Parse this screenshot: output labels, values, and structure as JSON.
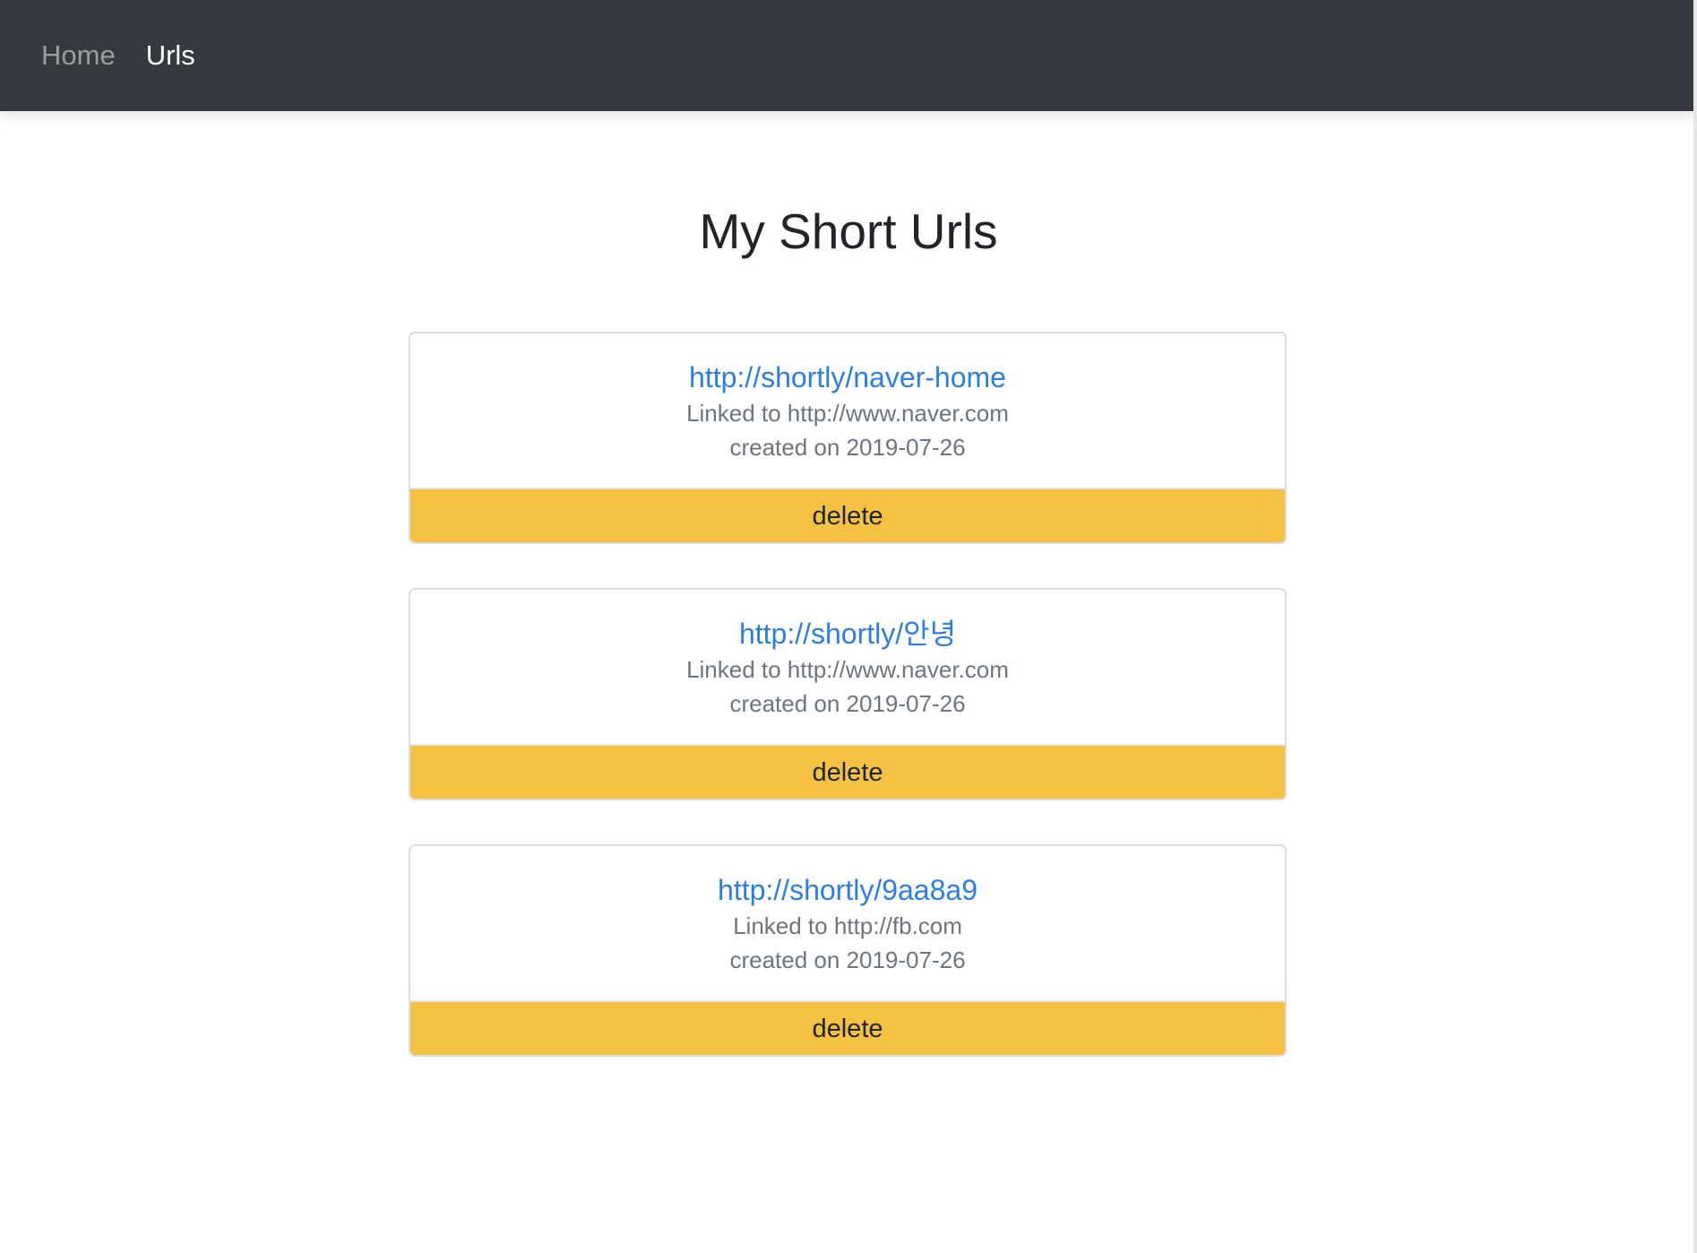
{
  "nav": {
    "home_label": "Home",
    "urls_label": "Urls"
  },
  "page": {
    "title": "My Short Urls"
  },
  "urls": [
    {
      "short_url": "http://shortly/naver-home",
      "linked_text": "Linked to http://www.naver.com",
      "created_text": "created on 2019-07-26",
      "delete_label": "delete"
    },
    {
      "short_url": "http://shortly/안녕",
      "linked_text": "Linked to http://www.naver.com",
      "created_text": "created on 2019-07-26",
      "delete_label": "delete"
    },
    {
      "short_url": "http://shortly/9aa8a9",
      "linked_text": "Linked to http://fb.com",
      "created_text": "created on 2019-07-26",
      "delete_label": "delete"
    }
  ],
  "colors": {
    "navbar": "#343a40",
    "link": "#2b7de9",
    "warning_button": "#f5c143",
    "muted_text": "#6c757d"
  }
}
